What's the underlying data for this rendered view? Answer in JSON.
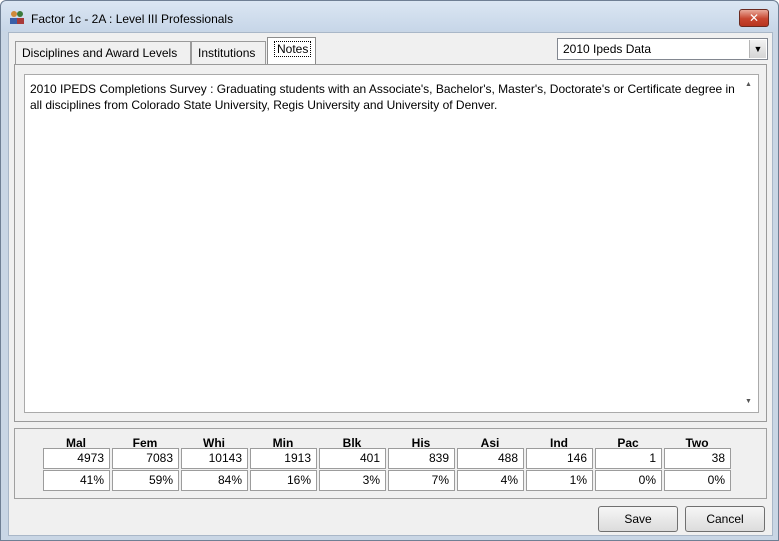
{
  "window": {
    "title": "Factor 1c - 2A : Level III Professionals",
    "close_label": "✕"
  },
  "tabs": [
    {
      "label": "Disciplines and Award Levels",
      "selected": false
    },
    {
      "label": "Institutions",
      "selected": false
    },
    {
      "label": "Notes",
      "selected": true
    }
  ],
  "data_source_select": {
    "value": "2010 Ipeds Data"
  },
  "notes": {
    "text": "2010 IPEDS Completions Survey : Graduating students with an Associate's, Bachelor's, Master's, Doctorate's or Certificate degree in all disciplines from Colorado State University, Regis University and University of Denver."
  },
  "stats": {
    "columns": [
      {
        "head": "Mal",
        "count": "4973",
        "pct": "41%"
      },
      {
        "head": "Fem",
        "count": "7083",
        "pct": "59%"
      },
      {
        "head": "Whi",
        "count": "10143",
        "pct": "84%"
      },
      {
        "head": "Min",
        "count": "1913",
        "pct": "16%"
      },
      {
        "head": "Blk",
        "count": "401",
        "pct": "3%"
      },
      {
        "head": "His",
        "count": "839",
        "pct": "7%"
      },
      {
        "head": "Asi",
        "count": "488",
        "pct": "4%"
      },
      {
        "head": "Ind",
        "count": "146",
        "pct": "1%"
      },
      {
        "head": "Pac",
        "count": "1",
        "pct": "0%"
      },
      {
        "head": "Two",
        "count": "38",
        "pct": "0%"
      }
    ]
  },
  "buttons": {
    "save": "Save",
    "cancel": "Cancel"
  },
  "icons": {
    "app": "app-people-icon",
    "close": "close-icon",
    "dropdown": "chevron-down-icon"
  }
}
